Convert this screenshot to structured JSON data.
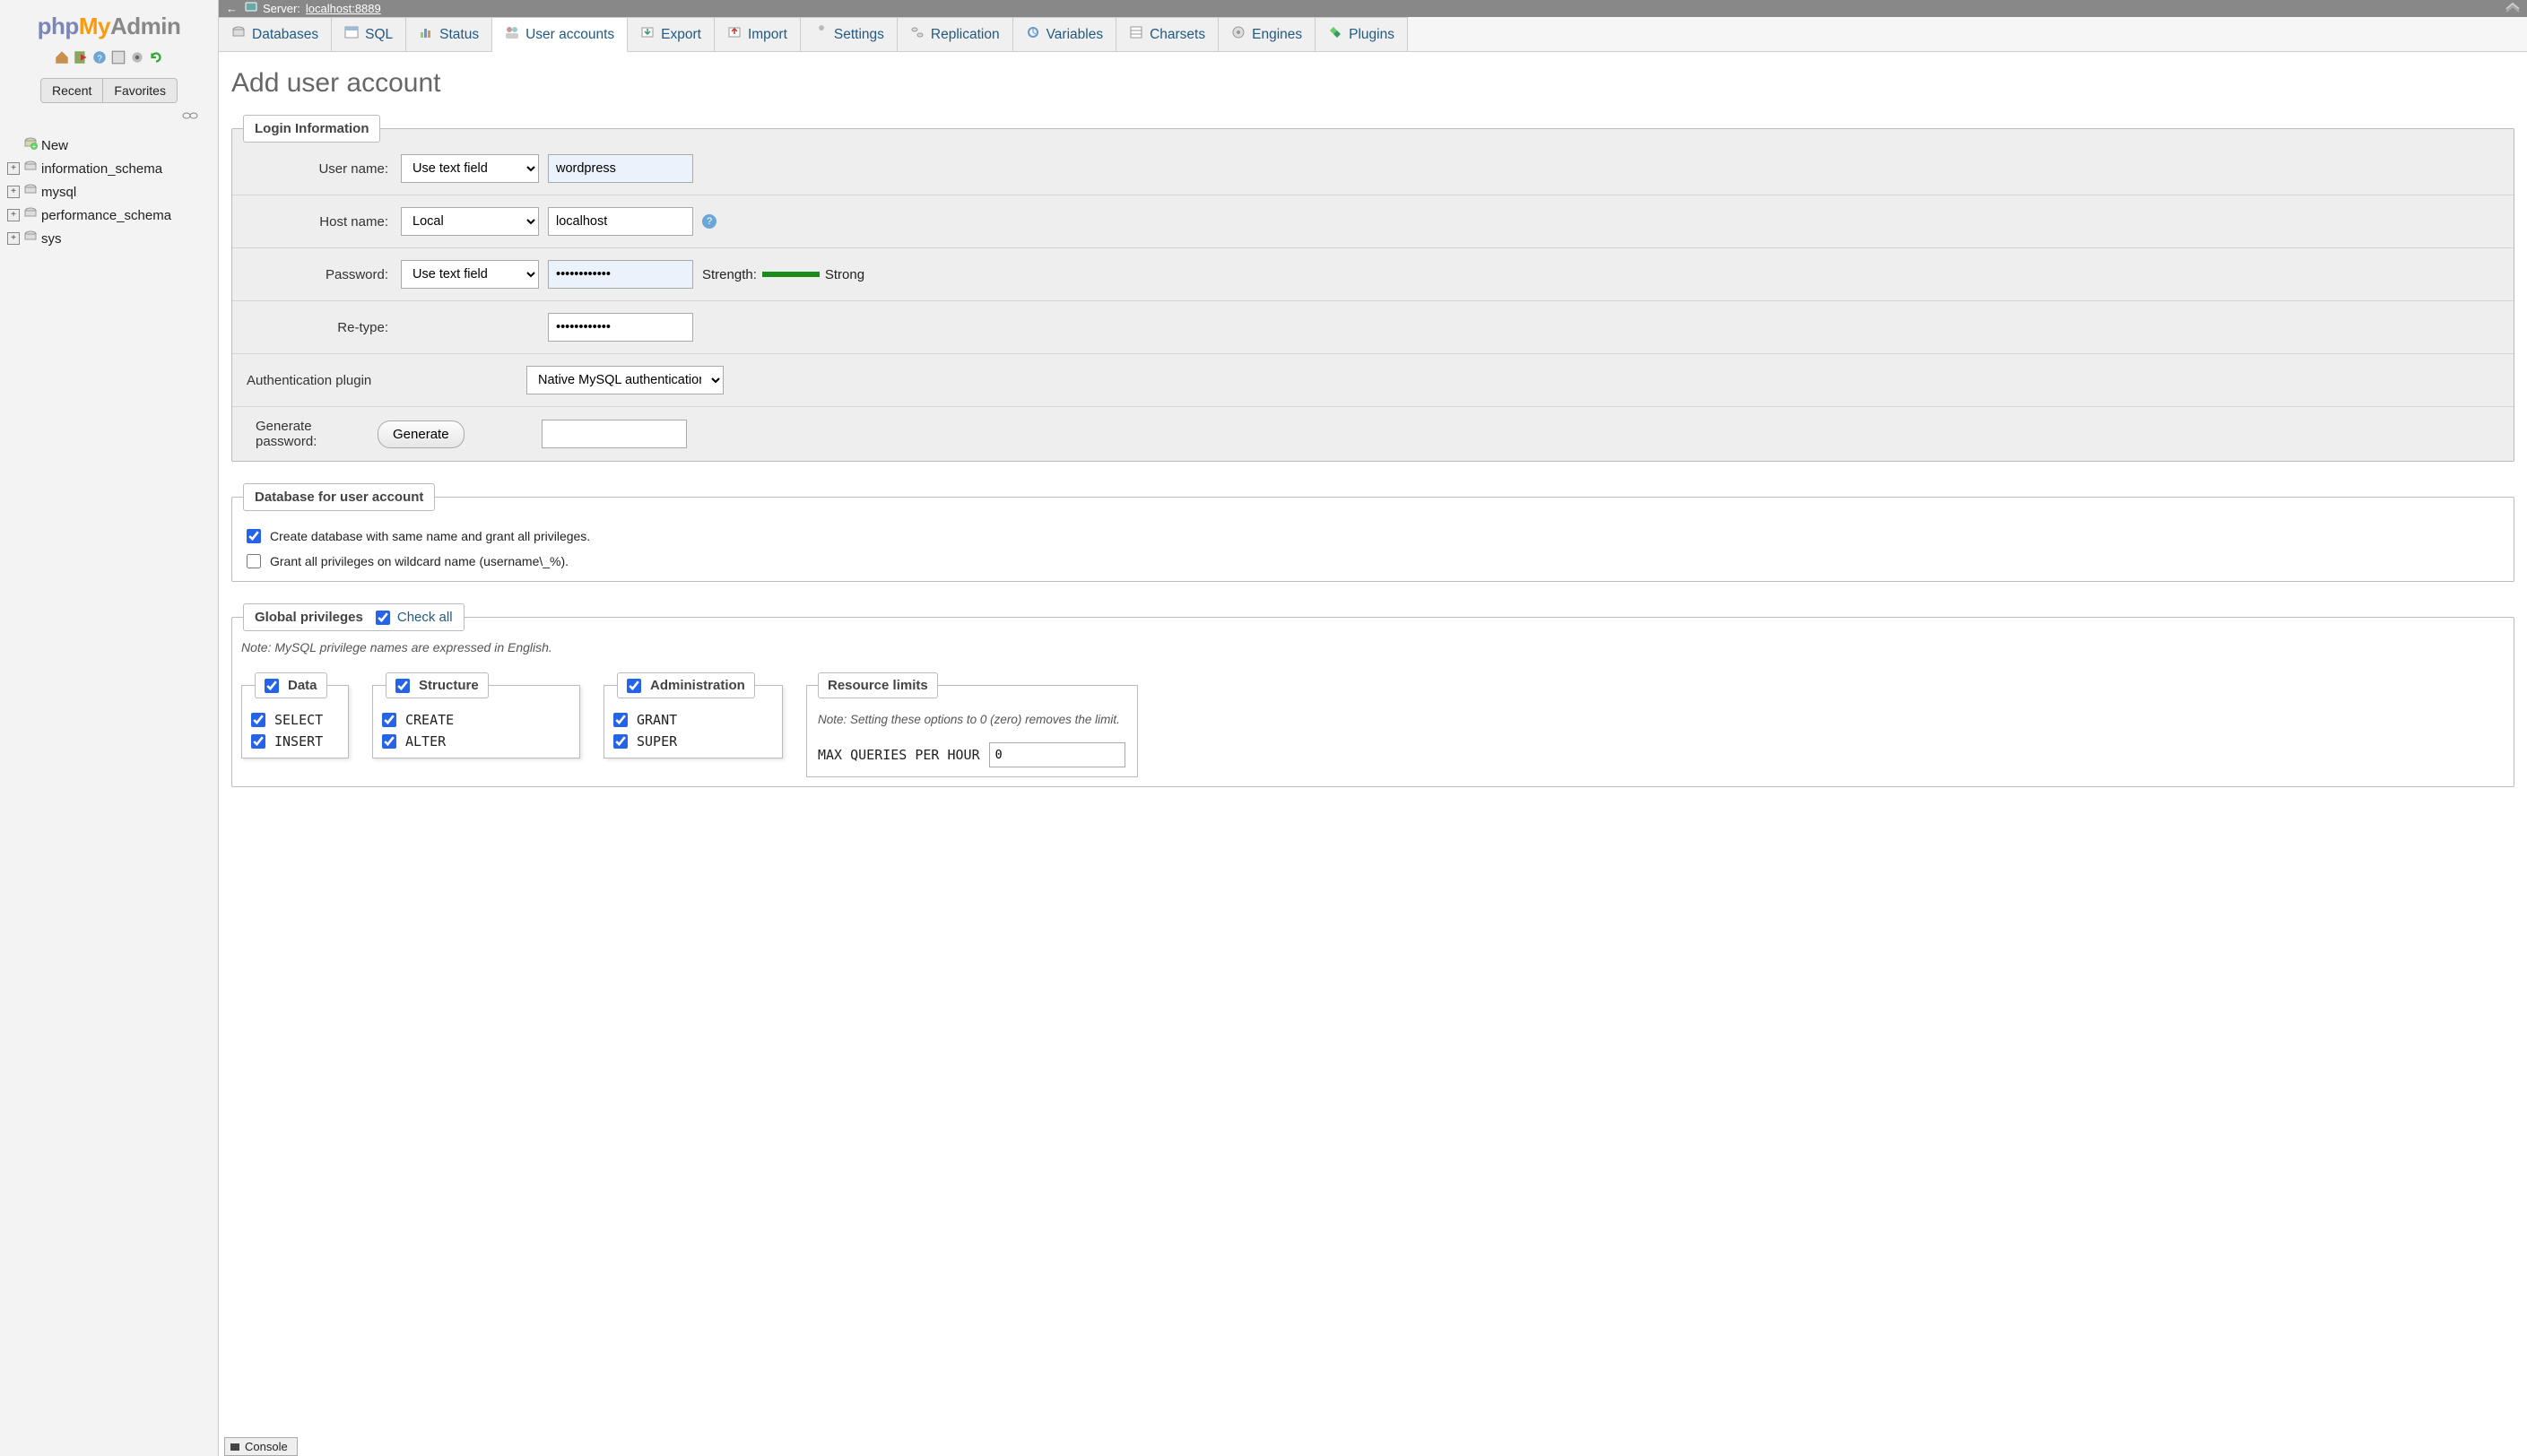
{
  "logo": {
    "php": "php",
    "my": "My",
    "admin": "Admin"
  },
  "sidebar": {
    "tabs": {
      "recent": "Recent",
      "favorites": "Favorites"
    },
    "tree": {
      "new_label": "New",
      "items": [
        "information_schema",
        "mysql",
        "performance_schema",
        "sys"
      ]
    }
  },
  "topbar": {
    "server_prefix": "Server:",
    "server_name": "localhost:8889"
  },
  "nav_tabs": [
    {
      "id": "databases",
      "label": "Databases",
      "icon": "db"
    },
    {
      "id": "sql",
      "label": "SQL",
      "icon": "sql"
    },
    {
      "id": "status",
      "label": "Status",
      "icon": "status"
    },
    {
      "id": "user_accounts",
      "label": "User accounts",
      "icon": "users"
    },
    {
      "id": "export",
      "label": "Export",
      "icon": "export"
    },
    {
      "id": "import",
      "label": "Import",
      "icon": "import"
    },
    {
      "id": "settings",
      "label": "Settings",
      "icon": "wrench"
    },
    {
      "id": "replication",
      "label": "Replication",
      "icon": "rep"
    },
    {
      "id": "variables",
      "label": "Variables",
      "icon": "var"
    },
    {
      "id": "charsets",
      "label": "Charsets",
      "icon": "char"
    },
    {
      "id": "engines",
      "label": "Engines",
      "icon": "eng"
    },
    {
      "id": "plugins",
      "label": "Plugins",
      "icon": "plug"
    }
  ],
  "page": {
    "title": "Add user account",
    "login_legend": "Login Information",
    "rows": {
      "username": {
        "label": "User name:",
        "select": "Use text field",
        "value": "wordpress"
      },
      "hostname": {
        "label": "Host name:",
        "select": "Local",
        "value": "localhost"
      },
      "password": {
        "label": "Password:",
        "select": "Use text field",
        "value": "••••••••••••",
        "strength_label": "Strength:",
        "strength_text": "Strong"
      },
      "retype": {
        "label": "Re-type:",
        "value": "••••••••••••"
      },
      "authplugin": {
        "label": "Authentication plugin",
        "value": "Native MySQL authentication"
      },
      "generate": {
        "label": "Generate password:",
        "button": "Generate",
        "value": ""
      }
    },
    "db_legend": "Database for user account",
    "db_opts": {
      "create_same": "Create database with same name and grant all privileges.",
      "grant_wild": "Grant all privileges on wildcard name (username\\_%)."
    },
    "global": {
      "legend": "Global privileges",
      "check_all": "Check all",
      "note": "Note: MySQL privilege names are expressed in English.",
      "groups": {
        "data": {
          "title": "Data",
          "items": [
            "SELECT",
            "INSERT"
          ]
        },
        "structure": {
          "title": "Structure",
          "items": [
            "CREATE",
            "ALTER"
          ]
        },
        "admin": {
          "title": "Administration",
          "items": [
            "GRANT",
            "SUPER"
          ]
        }
      },
      "resource": {
        "title": "Resource limits",
        "note": "Note: Setting these options to 0 (zero) removes the limit.",
        "row": {
          "label": "MAX QUERIES PER HOUR",
          "value": "0"
        }
      }
    }
  },
  "console": "Console"
}
